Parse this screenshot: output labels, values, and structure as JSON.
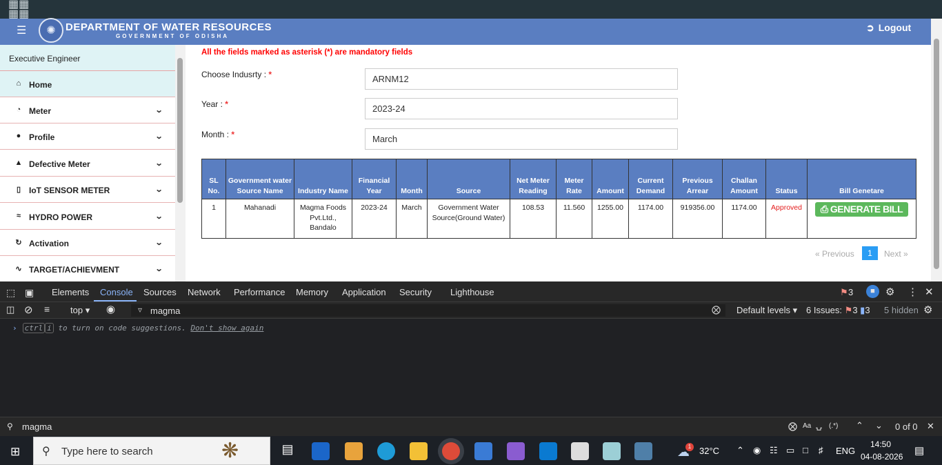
{
  "header": {
    "title": "DEPARTMENT OF WATER RESOURCES",
    "subtitle": "GOVERNMENT OF ODISHA",
    "logout_label": "Logout"
  },
  "sidebar": {
    "role": "Executive Engineer",
    "items": [
      {
        "label": "Home",
        "icon": "home-icon"
      },
      {
        "label": "Meter",
        "icon": "gauge-icon"
      },
      {
        "label": "Profile",
        "icon": "user-icon"
      },
      {
        "label": "Defective Meter",
        "icon": "warning-icon"
      },
      {
        "label": "IoT SENSOR METER",
        "icon": "sensor-icon"
      },
      {
        "label": "HYDRO POWER",
        "icon": "water-icon"
      },
      {
        "label": "Activation",
        "icon": "refresh-icon"
      },
      {
        "label": "TARGET/ACHIEVMENT",
        "icon": "chart-line-icon"
      }
    ]
  },
  "form": {
    "mandatory_note": "All the fields marked as asterisk (*) are mandatory fields",
    "industry_label": "Choose Indusrty : ",
    "industry_value": "ARNM12",
    "year_label": "Year : ",
    "year_value": "2023-24",
    "month_label": "Month : ",
    "month_value": "March",
    "asterisk": "*"
  },
  "table": {
    "headers": [
      "SL No.",
      "Government water Source Name",
      "Industry Name",
      "Financial Year",
      "Month",
      "Source",
      "Net Meter Reading",
      "Meter Rate",
      "Amount",
      "Current Demand",
      "Previous Arrear",
      "Challan Amount",
      "Status",
      "Bill Genetare"
    ],
    "rows": [
      {
        "sl": "1",
        "source_name": "Mahanadi",
        "industry": "Magma Foods Pvt.Ltd., Bandalo",
        "fy": "2023-24",
        "month": "March",
        "source": "Government Water Source(Ground Water)",
        "net_meter": "108.53",
        "rate": "11.560",
        "amount": "1255.00",
        "current_demand": "1174.00",
        "prev_arrear": "919356.00",
        "challan": "1174.00",
        "status": "Approved",
        "button": "GENERATE BILL"
      }
    ]
  },
  "pagination": {
    "prev": "« Previous",
    "page": "1",
    "next": "Next »"
  },
  "devtools": {
    "tabs": [
      "Elements",
      "Console",
      "Sources",
      "Network",
      "Performance",
      "Memory",
      "Application",
      "Security",
      "Lighthouse"
    ],
    "active_tab": "Console",
    "issues_badge": "3",
    "context": "top",
    "filter_value": "magma",
    "levels": "Default levels",
    "issues_label": "6 Issues:",
    "issues_red": "3",
    "issues_blue": "3",
    "hidden": "5 hidden",
    "hint_kbd1": "ctrl",
    "hint_kbd2": "i",
    "hint_text": " to turn on code suggestions. ",
    "hint_link": "Don't show again",
    "search_value": "magma",
    "search_aa": "Aa",
    "search_regex": "(.*)",
    "search_count": "0 of 0"
  },
  "taskbar": {
    "search_placeholder": "Type here to search",
    "weather": "32°C",
    "weather_badge": "1",
    "lang": "ENG",
    "time": "14:50",
    "date": "04-08-2026"
  }
}
